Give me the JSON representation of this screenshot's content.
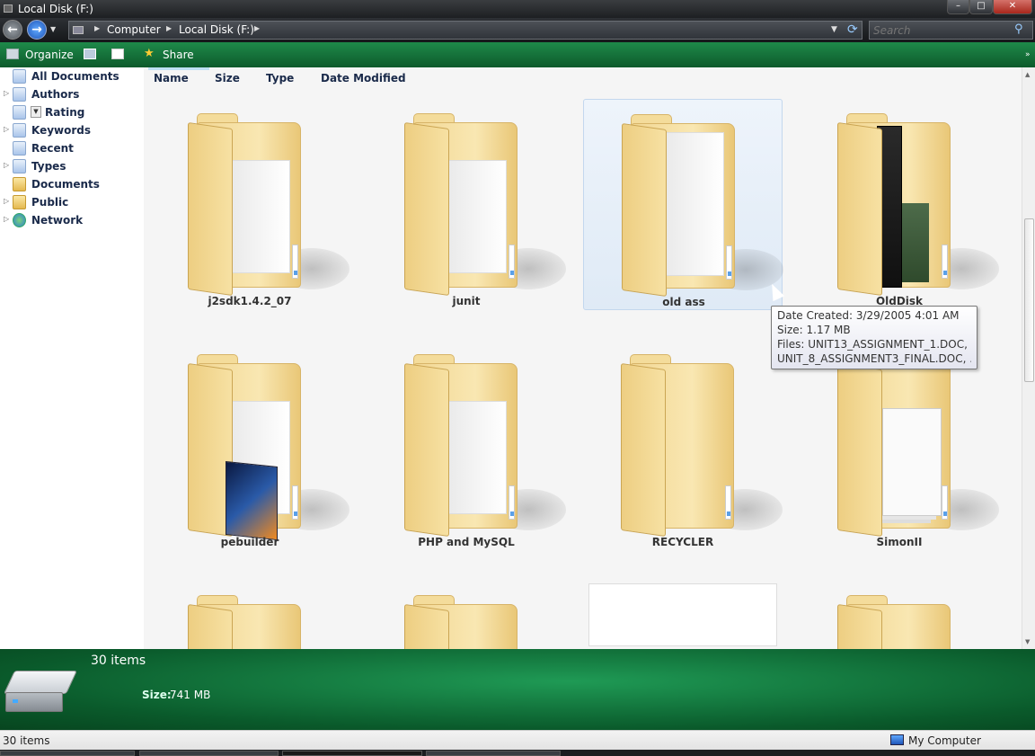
{
  "window": {
    "title": "Local Disk (F:)"
  },
  "address": {
    "crumbs": [
      "Computer",
      "Local Disk (F:)"
    ]
  },
  "search": {
    "placeholder": "Search"
  },
  "toolbar": {
    "organize_label": "Organize",
    "share_label": "Share"
  },
  "nav": {
    "items": [
      {
        "label": "All Documents",
        "icon": "search-folder-icon"
      },
      {
        "label": "Authors",
        "icon": "search-folder-icon"
      },
      {
        "label": "Rating",
        "icon": "search-folder-icon"
      },
      {
        "label": "Keywords",
        "icon": "search-folder-icon"
      },
      {
        "label": "Recent",
        "icon": "search-folder-icon"
      },
      {
        "label": "Types",
        "icon": "search-folder-icon"
      },
      {
        "label": "Documents",
        "icon": "folder-icon"
      },
      {
        "label": "Public",
        "icon": "folder-icon"
      },
      {
        "label": "Network",
        "icon": "network-icon"
      }
    ]
  },
  "columns": [
    "Name",
    "Size",
    "Type",
    "Date Modified"
  ],
  "folders": [
    {
      "name": "j2sdk1.4.2_07",
      "thumb": "papers"
    },
    {
      "name": "junit",
      "thumb": "papers"
    },
    {
      "name": "old ass",
      "thumb": "papers",
      "selected": true
    },
    {
      "name": "OldDisk",
      "thumb": "photos"
    },
    {
      "name": "pebuilder",
      "thumb": "cover"
    },
    {
      "name": "PHP and MySQL",
      "thumb": "papers"
    },
    {
      "name": "RECYCLER",
      "thumb": "empty"
    },
    {
      "name": "SimonII",
      "thumb": "docs"
    }
  ],
  "tooltip": {
    "lines": [
      "Date Created: 3/29/2005 4:01 AM",
      "Size: 1.17 MB",
      "Files: UNIT13_ASSIGNMENT_1.DOC,",
      "UNIT_8_ASSIGNMENT3_FINAL.DOC, ..."
    ]
  },
  "details": {
    "count": "30 items",
    "size_label": "Size:",
    "size_value": "741 MB"
  },
  "status": {
    "count": "30 items",
    "location": "My Computer"
  },
  "colors": {
    "toolbar": "#0d5a2b",
    "details": "#0a5a2b",
    "selection": "#dfeaf6"
  }
}
